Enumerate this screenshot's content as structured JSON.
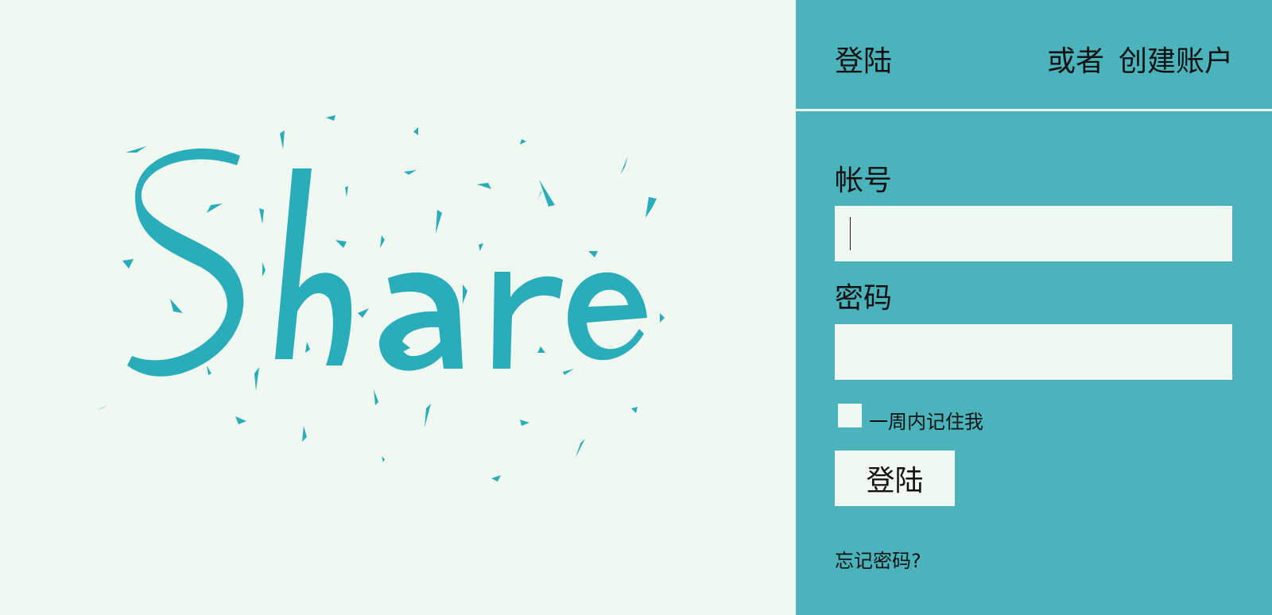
{
  "hero": {
    "logo_text": "Share",
    "brand_color": "#29adba",
    "background": "#f0f8f1"
  },
  "panel": {
    "background": "#4ab3bb",
    "header": {
      "title": "登陆",
      "or_text": "或者",
      "create_account": "创建账户"
    },
    "account": {
      "label": "帐号",
      "value": "",
      "placeholder": ""
    },
    "password": {
      "label": "密码",
      "value": "",
      "placeholder": ""
    },
    "remember": {
      "label": "一周内记住我",
      "checked": false
    },
    "login_button": "登陆",
    "forgot_link": "忘记密码?"
  }
}
